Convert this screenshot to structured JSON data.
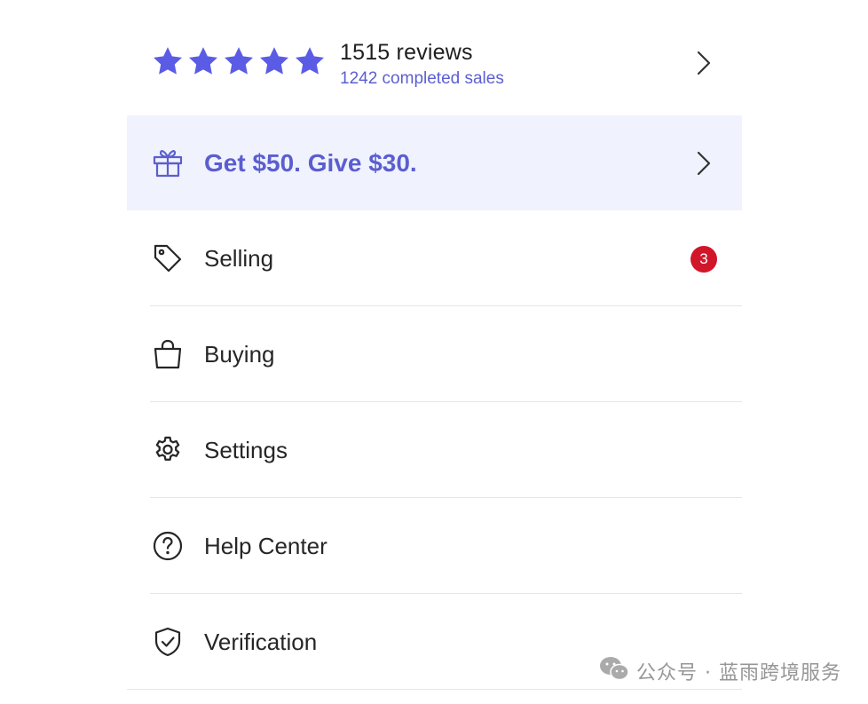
{
  "rating": {
    "stars": 5,
    "max_stars": 5,
    "reviews_text": "1515 reviews",
    "sales_text": "1242 completed sales",
    "star_color": "#5b5ce6"
  },
  "promo": {
    "label": "Get $50. Give $30.",
    "icon": "gift-icon",
    "background": "#f0f3fd",
    "text_color": "#5b5ecf"
  },
  "menu": {
    "items": [
      {
        "label": "Selling",
        "icon": "tag-icon",
        "badge": "3"
      },
      {
        "label": "Buying",
        "icon": "shopping-bag-icon"
      },
      {
        "label": "Settings",
        "icon": "gear-icon"
      },
      {
        "label": "Help Center",
        "icon": "question-circle-icon"
      },
      {
        "label": "Verification",
        "icon": "shield-check-icon"
      }
    ]
  },
  "badge_color": "#d1162a",
  "watermark": {
    "text": "公众号 · 蓝雨跨境服务",
    "icon": "wechat-icon"
  }
}
